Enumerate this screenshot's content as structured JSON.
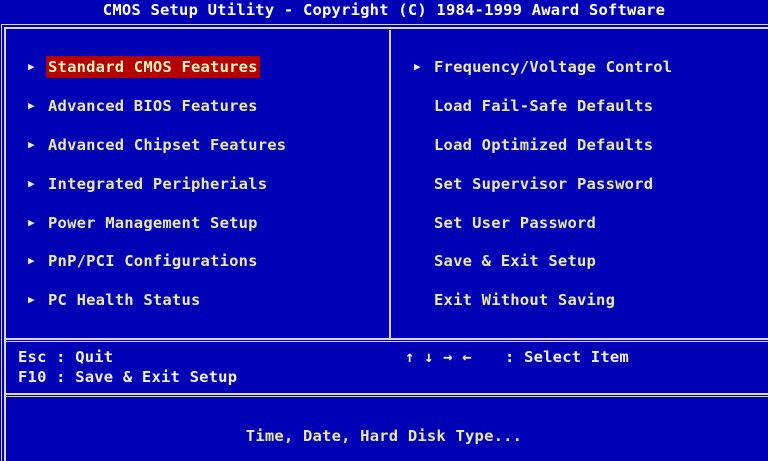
{
  "title": "CMOS Setup Utility - Copyright (C) 1984-1999 Award Software",
  "left_menu": [
    {
      "label": "Standard CMOS Features",
      "arrow": "▶",
      "selected": true
    },
    {
      "label": "Advanced BIOS Features",
      "arrow": "▶",
      "selected": false
    },
    {
      "label": "Advanced Chipset Features",
      "arrow": "▶",
      "selected": false
    },
    {
      "label": "Integrated Peripherials",
      "arrow": "▶",
      "selected": false
    },
    {
      "label": "Power Management Setup",
      "arrow": "▶",
      "selected": false
    },
    {
      "label": "PnP/PCI Configurations",
      "arrow": "▶",
      "selected": false
    },
    {
      "label": "PC Health Status",
      "arrow": "▶",
      "selected": false
    }
  ],
  "right_menu": [
    {
      "label": "Frequency/Voltage Control",
      "arrow": "▶"
    },
    {
      "label": "Load Fail-Safe Defaults",
      "arrow": ""
    },
    {
      "label": "Load Optimized Defaults",
      "arrow": ""
    },
    {
      "label": "Set Supervisor Password",
      "arrow": ""
    },
    {
      "label": "Set User Password",
      "arrow": ""
    },
    {
      "label": "Save & Exit Setup",
      "arrow": ""
    },
    {
      "label": "Exit Without Saving",
      "arrow": ""
    }
  ],
  "help": {
    "esc_line": "Esc : Quit",
    "f10_line": "F10 : Save & Exit Setup",
    "arrows_keys": "↑ ↓ → ←",
    "select_item": ": Select Item"
  },
  "status_text": "Time, Date, Hard Disk Type...",
  "colors": {
    "background": "#0000b4",
    "menu_text": "#e8e8a8",
    "highlight": "#b40000",
    "border": "#d8d8d8"
  }
}
